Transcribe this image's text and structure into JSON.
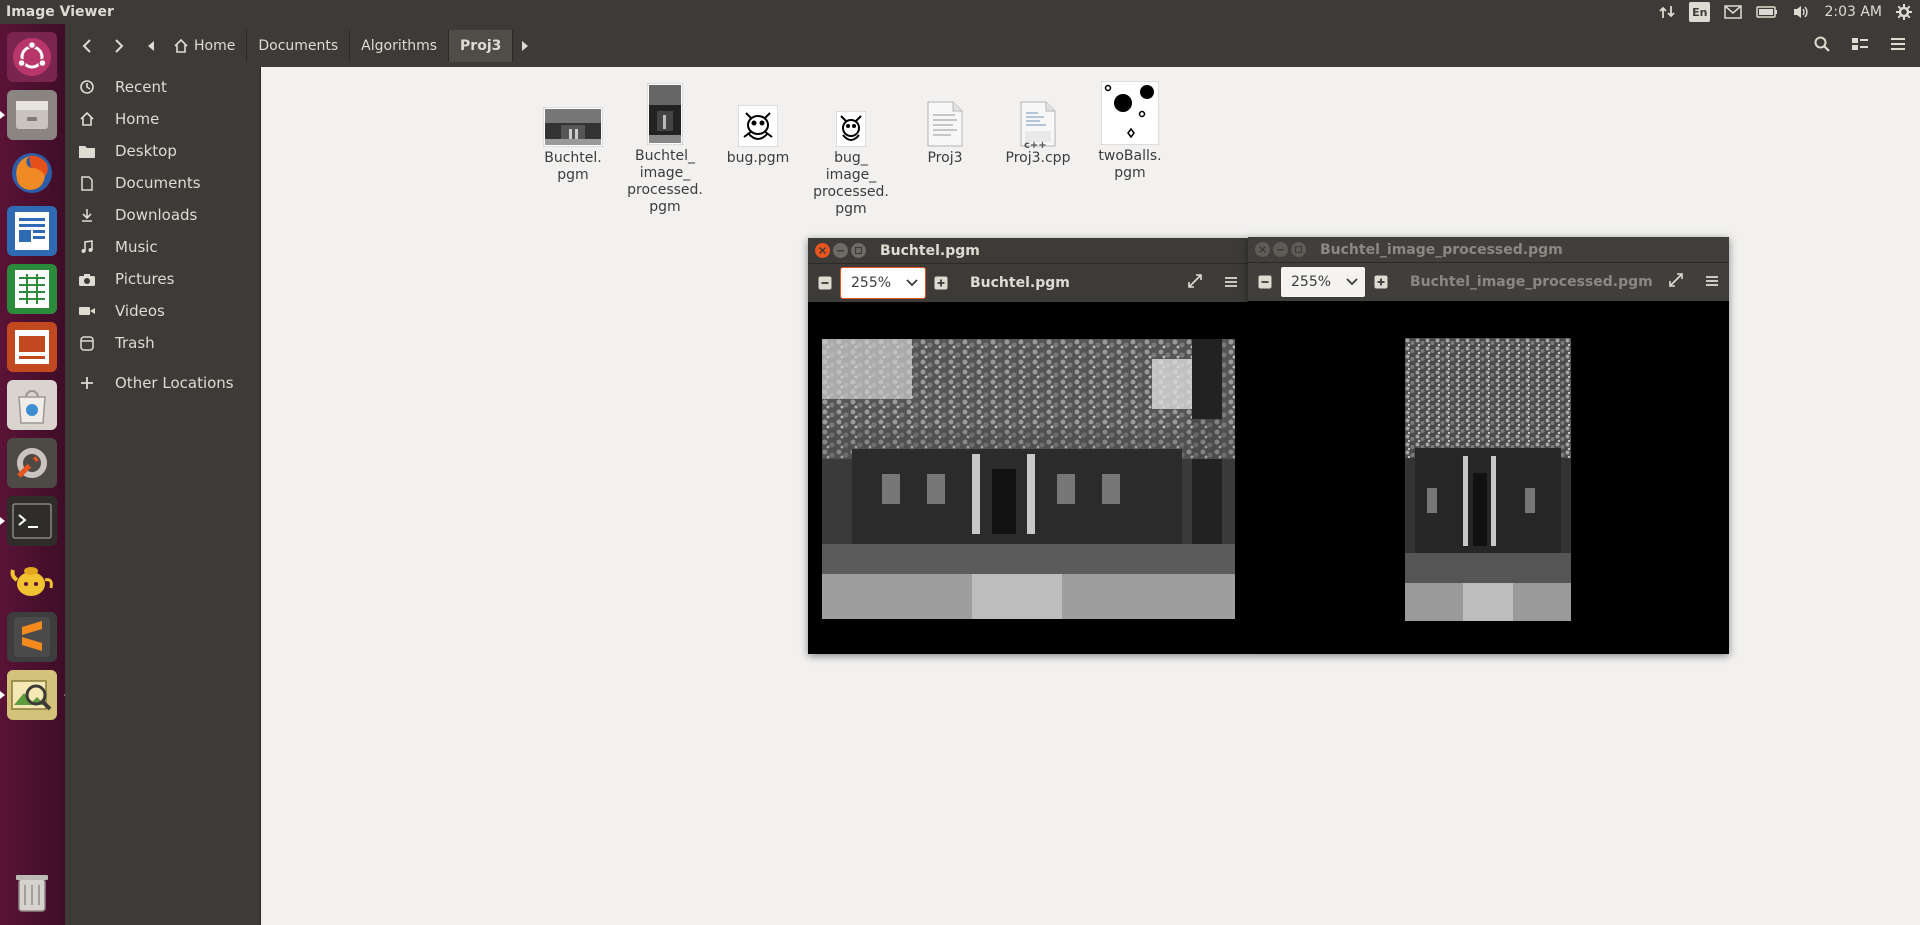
{
  "topbar": {
    "title": "Image Viewer",
    "language": "En",
    "time": "2:03 AM"
  },
  "breadcrumb": {
    "items": [
      "Home",
      "Documents",
      "Algorithms",
      "Proj3"
    ]
  },
  "sidebar": {
    "items": [
      {
        "label": "Recent",
        "icon": "clock-icon"
      },
      {
        "label": "Home",
        "icon": "home-icon"
      },
      {
        "label": "Desktop",
        "icon": "folder-icon"
      },
      {
        "label": "Documents",
        "icon": "document-icon"
      },
      {
        "label": "Downloads",
        "icon": "download-icon"
      },
      {
        "label": "Music",
        "icon": "music-icon"
      },
      {
        "label": "Pictures",
        "icon": "camera-icon"
      },
      {
        "label": "Videos",
        "icon": "video-icon"
      },
      {
        "label": "Trash",
        "icon": "trash-icon"
      },
      {
        "label": "Other Locations",
        "icon": "plus-icon"
      }
    ]
  },
  "files": [
    {
      "name": "Buchtel.\npgm",
      "kind": "photo-wide"
    },
    {
      "name": "Buchtel_\nimage_\nprocessed.\npgm",
      "kind": "photo-tall"
    },
    {
      "name": "bug.pgm",
      "kind": "bug"
    },
    {
      "name": "bug_\nimage_\nprocessed.\npgm",
      "kind": "bug"
    },
    {
      "name": "Proj3",
      "kind": "text"
    },
    {
      "name": "Proj3.cpp",
      "kind": "cpp",
      "badge": "c++"
    },
    {
      "name": "twoBalls.\npgm",
      "kind": "balls"
    }
  ],
  "viewers": [
    {
      "title": "Buchtel.pgm",
      "zoom": "255%",
      "name": "Buchtel.pgm",
      "active": true
    },
    {
      "title": "Buchtel_image_processed.pgm",
      "zoom": "255%",
      "name": "Buchtel_image_processed.pgm",
      "active": false
    }
  ],
  "colors": {
    "accent": "#e9541f",
    "panel": "#3c3b37",
    "launcher": "#5a1337"
  }
}
